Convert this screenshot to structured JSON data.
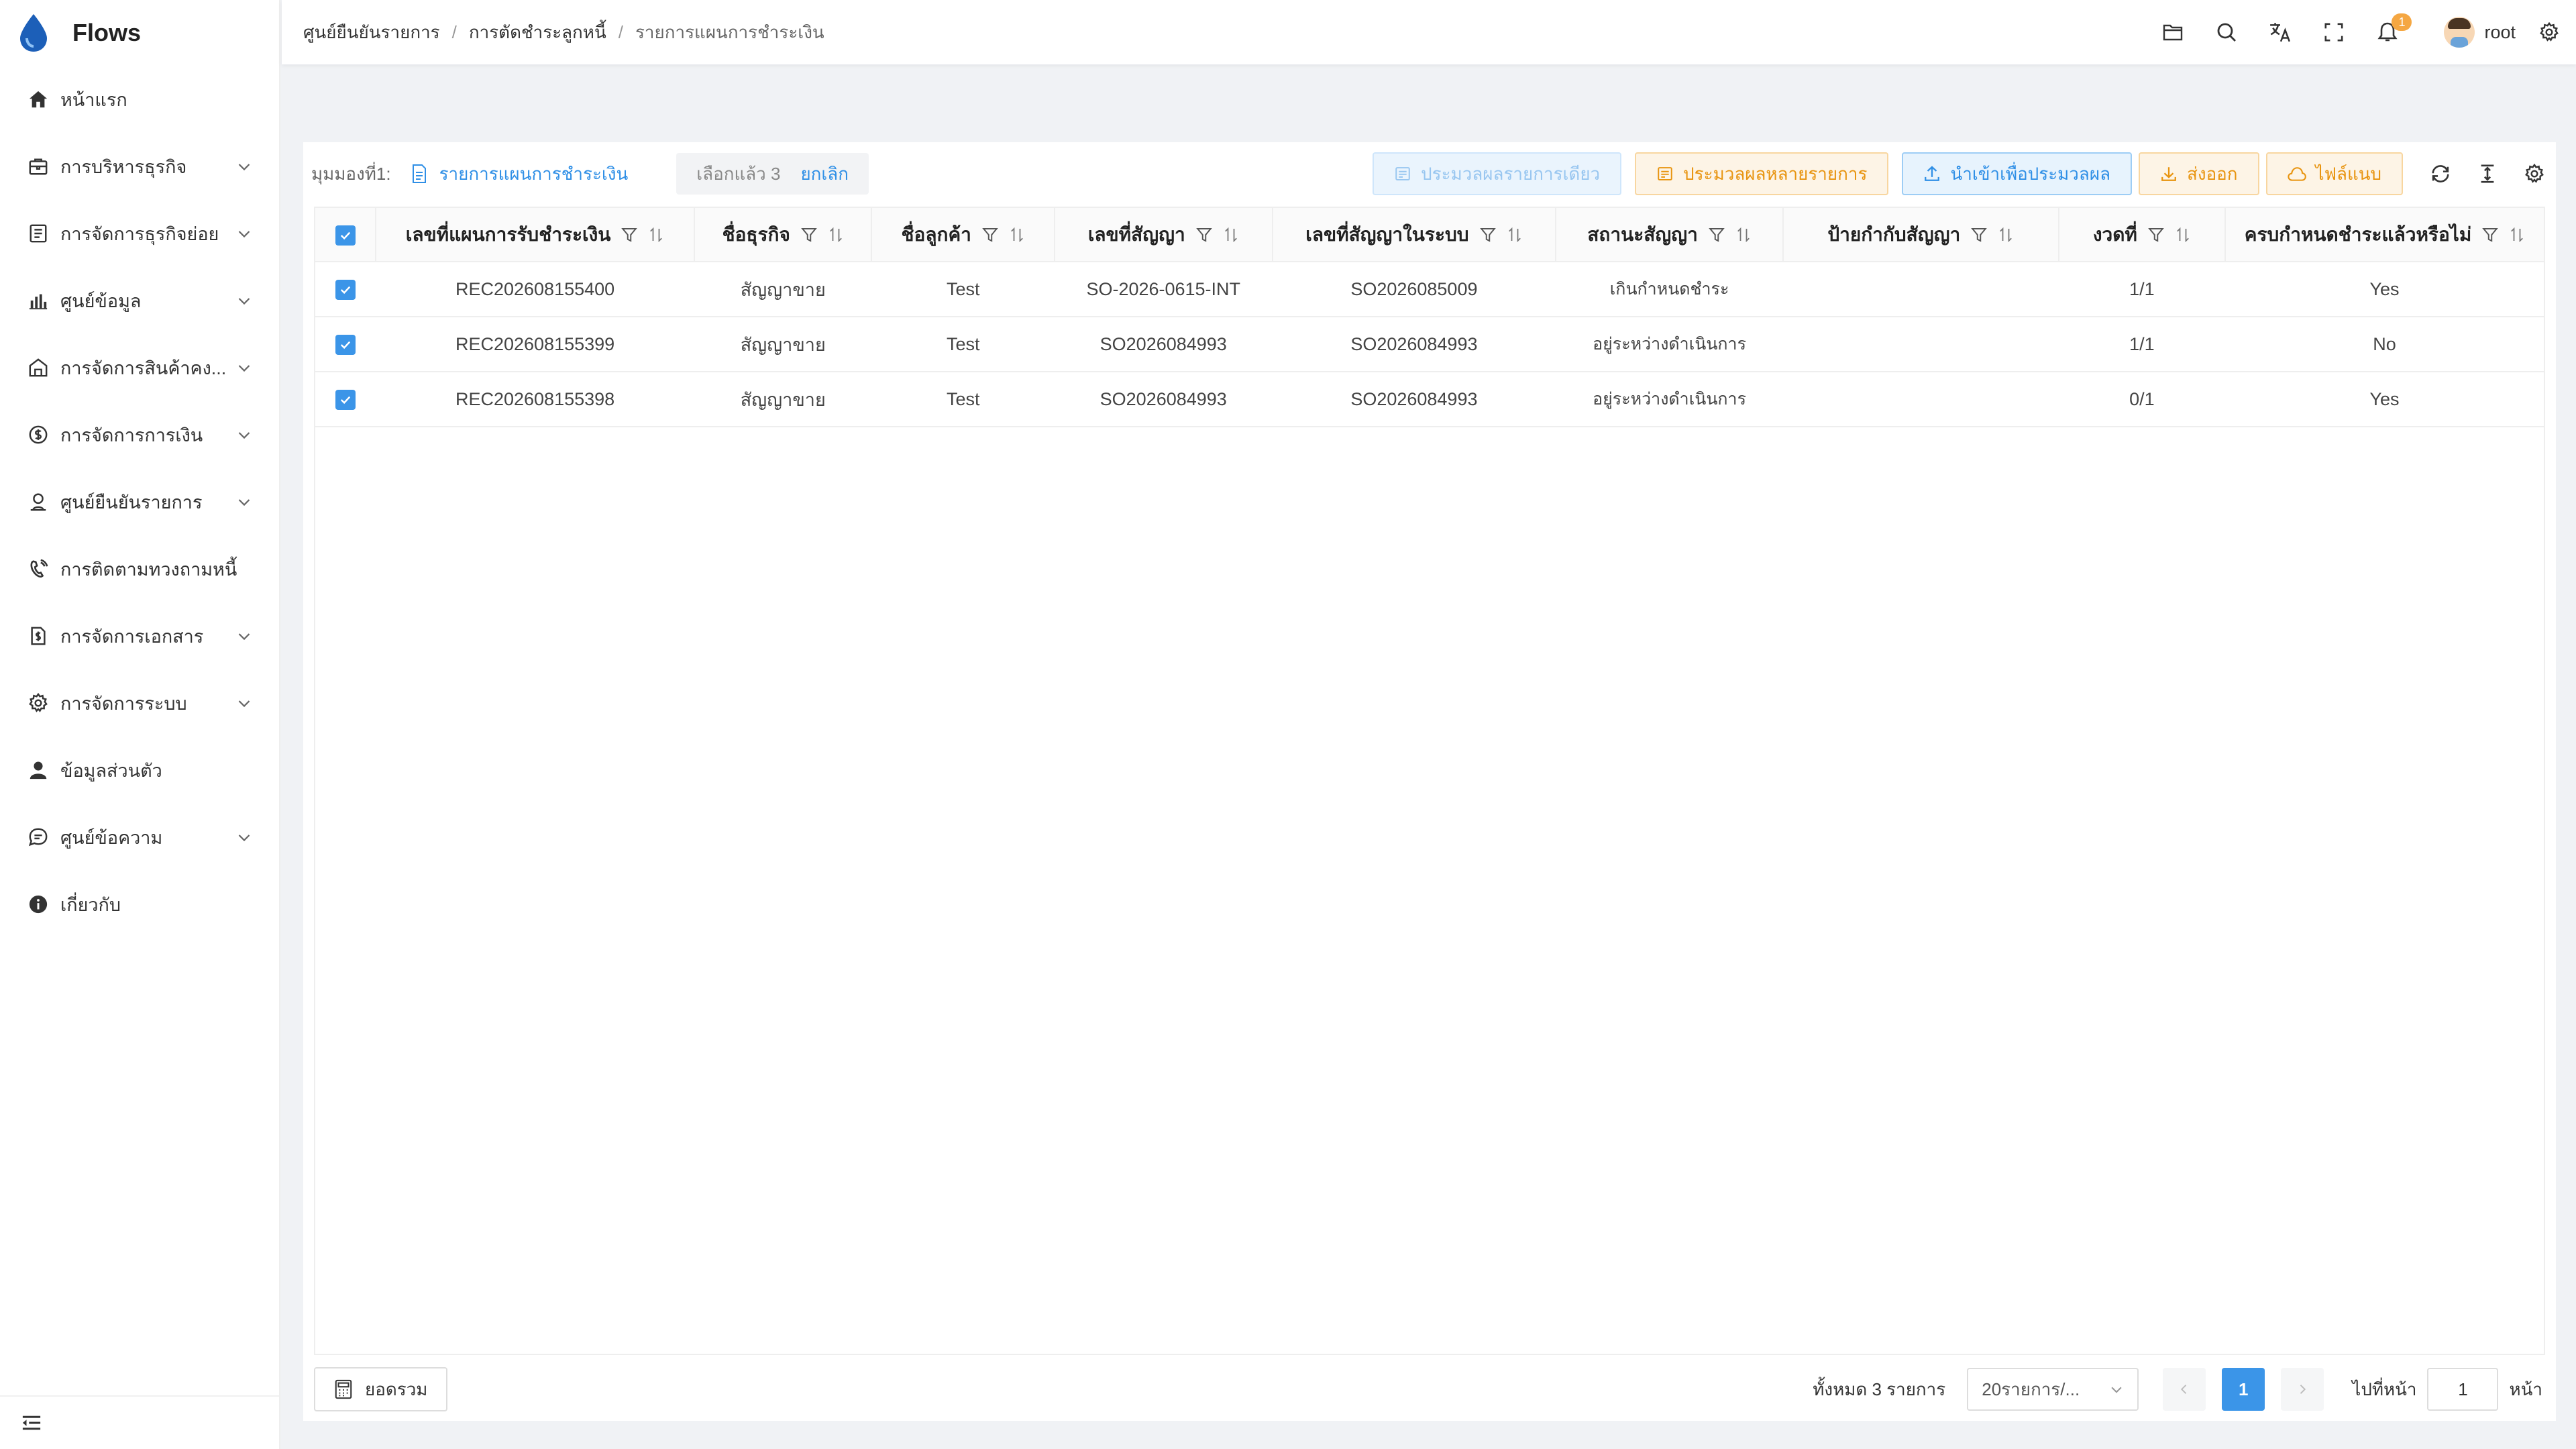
{
  "app": {
    "name": "Flows"
  },
  "sidebar": {
    "items": [
      {
        "label": "หน้าแรก",
        "icon": "home-icon",
        "expandable": false
      },
      {
        "label": "การบริหารธุรกิจ",
        "icon": "briefcase-icon",
        "expandable": true
      },
      {
        "label": "การจัดการธุรกิจย่อย",
        "icon": "list-icon",
        "expandable": true
      },
      {
        "label": "ศูนย์ข้อมูล",
        "icon": "bar-chart-icon",
        "expandable": true
      },
      {
        "label": "การจัดการสินค้าคง...",
        "icon": "warehouse-icon",
        "expandable": true
      },
      {
        "label": "การจัดการการเงิน",
        "icon": "dollar-icon",
        "expandable": true
      },
      {
        "label": "ศูนย์ยืนยันรายการ",
        "icon": "verify-user-icon",
        "expandable": true
      },
      {
        "label": "การติดตามทวงถามหนี้",
        "icon": "phone-call-icon",
        "expandable": false
      },
      {
        "label": "การจัดการเอกสาร",
        "icon": "document-icon",
        "expandable": true
      },
      {
        "label": "การจัดการระบบ",
        "icon": "gear-icon",
        "expandable": true
      },
      {
        "label": "ข้อมูลส่วนตัว",
        "icon": "person-icon",
        "expandable": false
      },
      {
        "label": "ศูนย์ข้อความ",
        "icon": "message-icon",
        "expandable": true
      },
      {
        "label": "เกี่ยวกับ",
        "icon": "info-icon",
        "expandable": false
      }
    ]
  },
  "header": {
    "breadcrumb": [
      "ศูนย์ยืนยันรายการ",
      "การตัดชำระลูกหนี้",
      "รายการแผนการชำระเงิน"
    ],
    "notification_count": "1",
    "username": "root"
  },
  "toolbar": {
    "view_label": "มุมมองที่1:",
    "view_name": "รายการแผนการชำระเงิน",
    "selected_text": "เลือกแล้ว 3",
    "cancel_label": "ยกเลิก",
    "buttons": {
      "process_single": "ประมวลผลรายการเดียว",
      "process_multi": "ประมวลผลหลายรายการ",
      "import_process": "นำเข้าเพื่อประมวลผล",
      "export": "ส่งออก",
      "attachment": "ไฟล์แนบ"
    }
  },
  "table": {
    "columns": [
      "เลขที่แผนการรับชำระเงิน",
      "ชื่อธุรกิจ",
      "ชื่อลูกค้า",
      "เลขที่สัญญา",
      "เลขที่สัญญาในระบบ",
      "สถานะสัญญา",
      "ป้ายกำกับสัญญา",
      "งวดที่",
      "ครบกำหนดชำระแล้วหรือไม่"
    ],
    "rows": [
      {
        "selected": true,
        "plan_no": "REC202608155400",
        "business": "สัญญาขาย",
        "customer": "Test",
        "contract_no": "SO-2026-0615-INT",
        "system_contract_no": "SO2026085009",
        "status": "เกินกำหนดชำระ",
        "tag": "",
        "period": "1/1",
        "due": "Yes"
      },
      {
        "selected": true,
        "plan_no": "REC202608155399",
        "business": "สัญญาขาย",
        "customer": "Test",
        "contract_no": "SO2026084993",
        "system_contract_no": "SO2026084993",
        "status": "อยู่ระหว่างดำเนินการ",
        "tag": "",
        "period": "1/1",
        "due": "No"
      },
      {
        "selected": true,
        "plan_no": "REC202608155398",
        "business": "สัญญาขาย",
        "customer": "Test",
        "contract_no": "SO2026084993",
        "system_contract_no": "SO2026084993",
        "status": "อยู่ระหว่างดำเนินการ",
        "tag": "",
        "period": "0/1",
        "due": "Yes"
      }
    ]
  },
  "footer": {
    "summary_label": "ยอดรวม",
    "total_text": "ทั้งหมด 3 รายการ",
    "page_size": "20รายการ/...",
    "current_page": "1",
    "goto_label": "ไปที่หน้า",
    "goto_value": "1",
    "page_unit": "หน้า"
  },
  "colors": {
    "primary": "#3b95e8",
    "orange": "#e8940f",
    "badge": "#f5a742"
  }
}
